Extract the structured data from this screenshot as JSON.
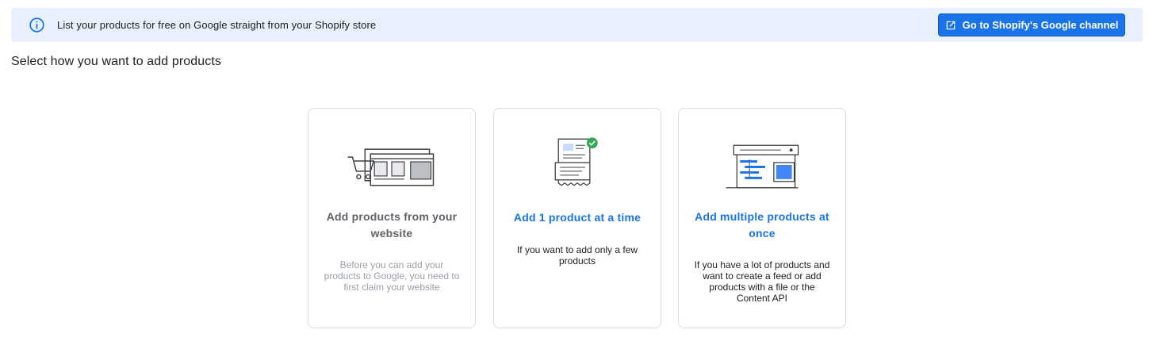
{
  "banner": {
    "message": "List your products for free on Google straight from your Shopify store",
    "button_label": "Go to Shopify's Google channel"
  },
  "heading": "Select how you want to add products",
  "cards": [
    {
      "title": "Add products from your website",
      "description": "Before you can add your products to Google, you need to first claim your website",
      "state": "disabled"
    },
    {
      "title": "Add 1 product at a time",
      "description": "If you want to add only a few products",
      "state": "active"
    },
    {
      "title": "Add multiple products at once",
      "description": "If you have a lot of products and want to create a feed or add products with a file or the Content API",
      "state": "active"
    }
  ],
  "colors": {
    "accent": "#1a73e8",
    "banner_bg": "#e8f0fe",
    "success": "#34a853",
    "card_border": "#dadce0"
  },
  "icons": [
    "info-icon",
    "open-in-new-icon",
    "shopping-cart-website-illustration",
    "single-product-receipt-illustration",
    "multiple-products-feed-illustration"
  ]
}
